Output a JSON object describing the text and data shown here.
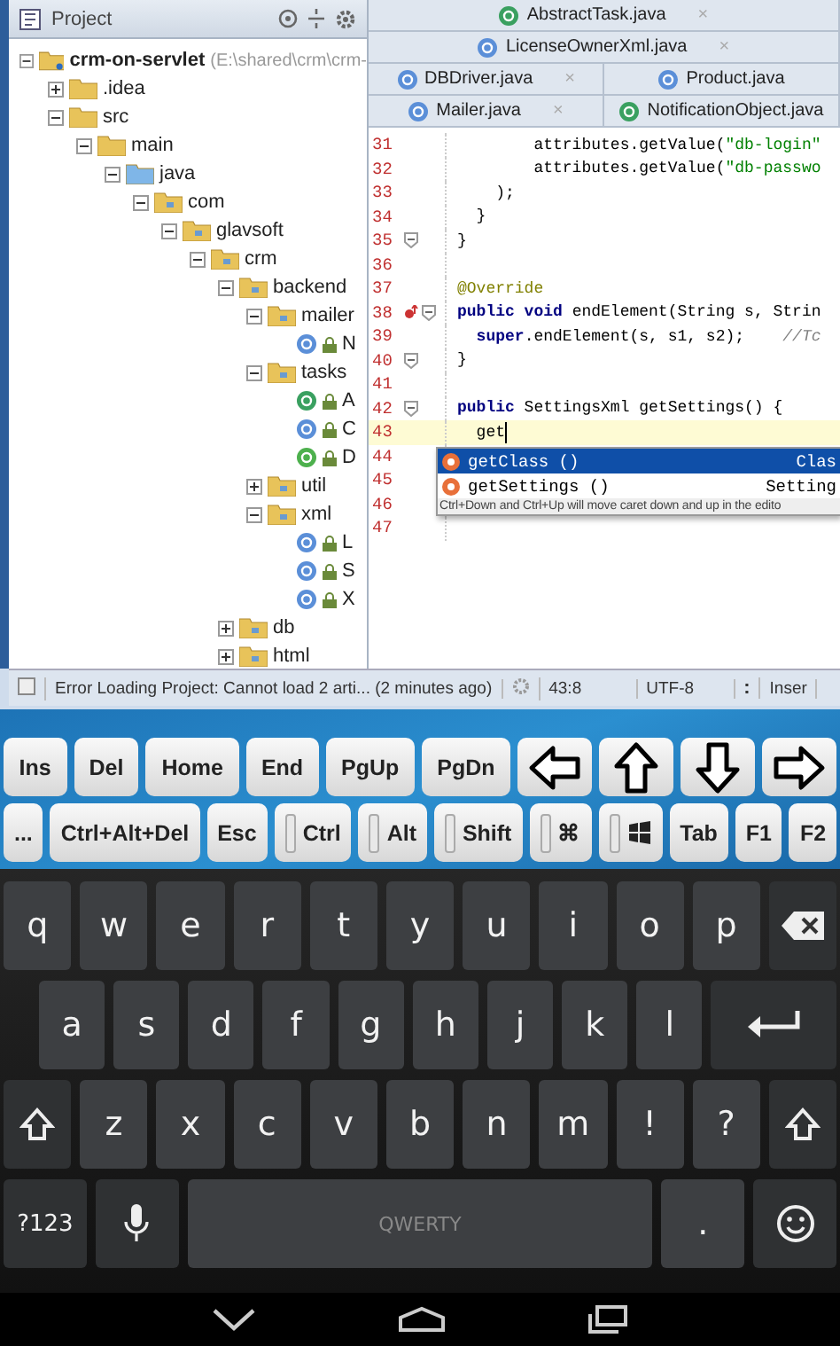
{
  "project_panel": {
    "title": "Project",
    "tree": [
      {
        "label": "crm-on-servlet",
        "path": "(E:\\shared\\crm\\crm-",
        "kind": "module",
        "expanded": true,
        "children": [
          {
            "label": ".idea",
            "kind": "folder",
            "expanded": false
          },
          {
            "label": "src",
            "kind": "folder",
            "expanded": true,
            "children": [
              {
                "label": "main",
                "kind": "folder",
                "expanded": true,
                "children": [
                  {
                    "label": "java",
                    "kind": "source",
                    "expanded": true,
                    "children": [
                      {
                        "label": "com",
                        "kind": "package",
                        "expanded": true,
                        "children": [
                          {
                            "label": "glavsoft",
                            "kind": "package",
                            "expanded": true,
                            "children": [
                              {
                                "label": "crm",
                                "kind": "package",
                                "expanded": true,
                                "children": [
                                  {
                                    "label": "backend",
                                    "kind": "package",
                                    "expanded": true,
                                    "children": [
                                      {
                                        "label": "mailer",
                                        "kind": "package",
                                        "expanded": true,
                                        "children": [
                                          {
                                            "label": "N",
                                            "kind": "class"
                                          }
                                        ]
                                      },
                                      {
                                        "label": "tasks",
                                        "kind": "package",
                                        "expanded": true,
                                        "children": [
                                          {
                                            "label": "A",
                                            "kind": "abstract"
                                          },
                                          {
                                            "label": "C",
                                            "kind": "class"
                                          },
                                          {
                                            "label": "D",
                                            "kind": "interface"
                                          }
                                        ]
                                      },
                                      {
                                        "label": "util",
                                        "kind": "package",
                                        "expanded": false
                                      },
                                      {
                                        "label": "xml",
                                        "kind": "package",
                                        "expanded": true,
                                        "children": [
                                          {
                                            "label": "L",
                                            "kind": "class"
                                          },
                                          {
                                            "label": "S",
                                            "kind": "class"
                                          },
                                          {
                                            "label": "X",
                                            "kind": "class"
                                          }
                                        ]
                                      }
                                    ]
                                  },
                                  {
                                    "label": "db",
                                    "kind": "package",
                                    "expanded": false
                                  },
                                  {
                                    "label": "html",
                                    "kind": "package",
                                    "expanded": false
                                  }
                                ]
                              }
                            ]
                          }
                        ]
                      }
                    ]
                  }
                ]
              }
            ]
          }
        ]
      }
    ]
  },
  "editor": {
    "tab_rows": [
      [
        {
          "label": "AbstractTask.java",
          "kind": "abstract",
          "close": "×"
        }
      ],
      [
        {
          "label": "LicenseOwnerXml.java",
          "kind": "class",
          "close": "×"
        }
      ],
      [
        {
          "label": "DBDriver.java",
          "kind": "class",
          "close": "×"
        },
        {
          "label": "Product.java",
          "kind": "class"
        }
      ],
      [
        {
          "label": "Mailer.java",
          "kind": "class",
          "close": "×"
        },
        {
          "label": "NotificationObject.java",
          "kind": "abstract"
        }
      ]
    ],
    "lines": [
      {
        "number": "31",
        "kind": "plain",
        "current": false,
        "tokens": [
          {
            "text": "        attributes.getValue(",
            "kind": "plain"
          },
          {
            "text": "\"db-login\"",
            "kind": "string"
          }
        ]
      },
      {
        "number": "32",
        "kind": "plain",
        "current": false,
        "tokens": [
          {
            "text": "        attributes.getValue(",
            "kind": "plain"
          },
          {
            "text": "\"db-passwo",
            "kind": "string"
          }
        ]
      },
      {
        "number": "33",
        "kind": "plain",
        "current": false,
        "tokens": [
          {
            "text": "    );",
            "kind": "plain"
          }
        ]
      },
      {
        "number": "34",
        "kind": "plain",
        "current": false,
        "tokens": [
          {
            "text": "  }",
            "kind": "plain"
          }
        ]
      },
      {
        "number": "35",
        "kind": "fold",
        "current": false,
        "tokens": [
          {
            "text": "}",
            "kind": "plain"
          }
        ]
      },
      {
        "number": "36",
        "kind": "plain",
        "current": false
      },
      {
        "number": "37",
        "kind": "plain",
        "current": false,
        "tokens": [
          {
            "text": "@Override",
            "kind": "annotation"
          }
        ]
      },
      {
        "number": "38",
        "kind": "override",
        "current": false,
        "tokens": [
          {
            "text": "public void",
            "kind": "keyword"
          },
          {
            "text": " endElement(String s, Strin",
            "kind": "plain"
          }
        ]
      },
      {
        "number": "39",
        "kind": "plain",
        "current": false,
        "tokens": [
          {
            "text": "  super",
            "kind": "keyword"
          },
          {
            "text": ".endElement(s, s1, s2);    ",
            "kind": "plain"
          },
          {
            "text": "//Tc",
            "kind": "comment"
          }
        ]
      },
      {
        "number": "40",
        "kind": "fold",
        "current": false,
        "tokens": [
          {
            "text": "}",
            "kind": "plain"
          }
        ]
      },
      {
        "number": "41",
        "kind": "plain",
        "current": false
      },
      {
        "number": "42",
        "kind": "fold",
        "current": false,
        "tokens": [
          {
            "text": "public",
            "kind": "keyword"
          },
          {
            "text": " SettingsXml getSettings() {",
            "kind": "plain"
          }
        ]
      },
      {
        "number": "43",
        "kind": "plain",
        "current": true,
        "tokens": [
          {
            "text": "  get",
            "kind": "plain"
          }
        ]
      },
      {
        "number": "44",
        "kind": "plain",
        "current": false
      },
      {
        "number": "45",
        "kind": "plain",
        "current": false
      },
      {
        "number": "46",
        "kind": "plain",
        "current": false
      },
      {
        "number": "47",
        "kind": "plain",
        "current": false
      }
    ],
    "completion": {
      "items": [
        {
          "name": "getClass ()",
          "type": "Clas",
          "selected": true
        },
        {
          "name": "getSettings ()",
          "type": "Setting",
          "selected": false
        }
      ],
      "hint": "Ctrl+Down and Ctrl+Up will move caret down and up in the edito"
    }
  },
  "status_bar": {
    "message": "Error Loading Project: Cannot load 2 arti... (2 minutes ago)",
    "position": "43:8",
    "encoding": "UTF-8",
    "separator": ":",
    "mode": "Inser"
  },
  "special_keys": [
    [
      {
        "kind": "text",
        "label": "Ins"
      },
      {
        "kind": "text",
        "label": "Del"
      },
      {
        "kind": "text",
        "label": "Home"
      },
      {
        "kind": "text",
        "label": "End"
      },
      {
        "kind": "text",
        "label": "PgUp"
      },
      {
        "kind": "text",
        "label": "PgDn"
      },
      {
        "kind": "arrow-left"
      },
      {
        "kind": "arrow-up"
      },
      {
        "kind": "arrow-down"
      },
      {
        "kind": "arrow-right"
      }
    ],
    [
      {
        "kind": "text",
        "label": "..."
      },
      {
        "kind": "text",
        "label": "Ctrl+Alt+Del"
      },
      {
        "kind": "text",
        "label": "Esc"
      },
      {
        "kind": "toggle",
        "label": "Ctrl",
        "on": false
      },
      {
        "kind": "toggle",
        "label": "Alt",
        "on": false
      },
      {
        "kind": "toggle",
        "label": "Shift",
        "on": false
      },
      {
        "kind": "toggle",
        "label": "⌘",
        "on": false
      },
      {
        "kind": "windows-toggle",
        "on": false
      },
      {
        "kind": "text",
        "label": "Tab"
      },
      {
        "kind": "text",
        "label": "F1"
      },
      {
        "kind": "text",
        "label": "F2"
      }
    ]
  ],
  "keyboard": [
    [
      {
        "kind": "char",
        "label": "q"
      },
      {
        "kind": "char",
        "label": "w"
      },
      {
        "kind": "char",
        "label": "e"
      },
      {
        "kind": "char",
        "label": "r"
      },
      {
        "kind": "char",
        "label": "t"
      },
      {
        "kind": "char",
        "label": "y"
      },
      {
        "kind": "char",
        "label": "u"
      },
      {
        "kind": "char",
        "label": "i"
      },
      {
        "kind": "char",
        "label": "o"
      },
      {
        "kind": "char",
        "label": "p"
      },
      {
        "kind": "backspace"
      }
    ],
    [
      {
        "kind": "char",
        "label": "a"
      },
      {
        "kind": "char",
        "label": "s"
      },
      {
        "kind": "char",
        "label": "d"
      },
      {
        "kind": "char",
        "label": "f"
      },
      {
        "kind": "char",
        "label": "g"
      },
      {
        "kind": "char",
        "label": "h"
      },
      {
        "kind": "char",
        "label": "j"
      },
      {
        "kind": "char",
        "label": "k"
      },
      {
        "kind": "char",
        "label": "l"
      },
      {
        "kind": "enter"
      }
    ],
    [
      {
        "kind": "shift"
      },
      {
        "kind": "char",
        "label": "z"
      },
      {
        "kind": "char",
        "label": "x"
      },
      {
        "kind": "char",
        "label": "c"
      },
      {
        "kind": "char",
        "label": "v"
      },
      {
        "kind": "char",
        "label": "b"
      },
      {
        "kind": "char",
        "label": "n"
      },
      {
        "kind": "char",
        "label": "m"
      },
      {
        "kind": "char",
        "label": "!"
      },
      {
        "kind": "char",
        "label": "?"
      },
      {
        "kind": "shift"
      }
    ],
    [
      {
        "kind": "small",
        "label": "?123"
      },
      {
        "kind": "mic"
      },
      {
        "kind": "space",
        "label": "QWERTY"
      },
      {
        "kind": "char",
        "label": "."
      },
      {
        "kind": "smiley"
      }
    ]
  ]
}
